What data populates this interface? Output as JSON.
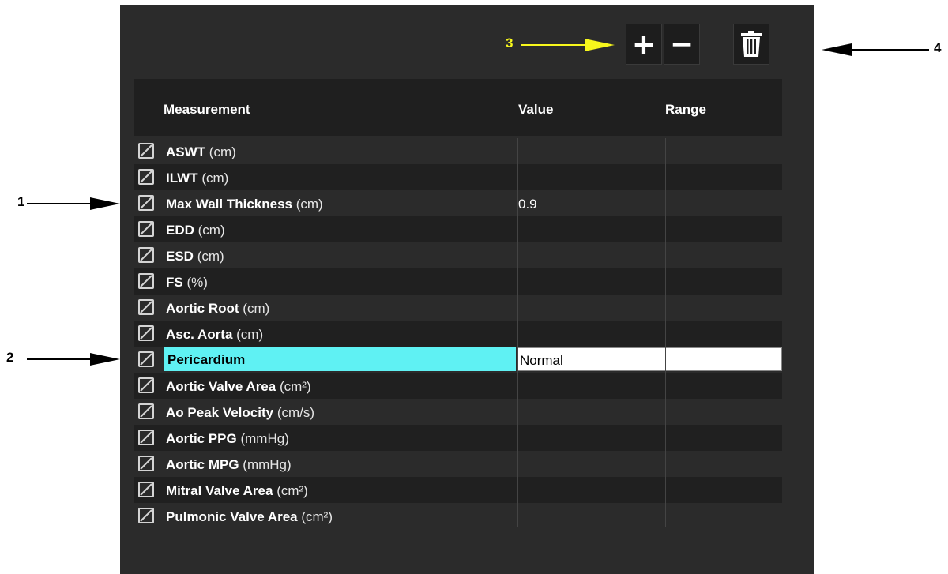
{
  "toolbar": {
    "add_label": "+",
    "remove_label": "−",
    "delete_icon": "trash-icon"
  },
  "table": {
    "headers": {
      "measurement": "Measurement",
      "value": "Value",
      "range": "Range"
    },
    "rows": [
      {
        "name": "ASWT",
        "unit": "(cm)",
        "value": "",
        "checked": true
      },
      {
        "name": "ILWT",
        "unit": "(cm)",
        "value": "",
        "checked": true
      },
      {
        "name": "Max Wall Thickness",
        "unit": "(cm)",
        "value": "0.9",
        "checked": true
      },
      {
        "name": "EDD",
        "unit": "(cm)",
        "value": "",
        "checked": true
      },
      {
        "name": "ESD",
        "unit": "(cm)",
        "value": "",
        "checked": true
      },
      {
        "name": "FS",
        "unit": "(%)",
        "value": "",
        "checked": true
      },
      {
        "name": "Aortic Root",
        "unit": "(cm)",
        "value": "",
        "checked": true
      },
      {
        "name": "Asc. Aorta",
        "unit": "(cm)",
        "value": "",
        "checked": true
      },
      {
        "name": "Pericardium",
        "unit": "",
        "value": "Normal",
        "checked": true,
        "editing": true
      },
      {
        "name": "Aortic Valve Area",
        "unit": "(cm²)",
        "value": "",
        "checked": true
      },
      {
        "name": "Ao Peak Velocity",
        "unit": "(cm/s)",
        "value": "",
        "checked": true
      },
      {
        "name": "Aortic PPG",
        "unit": "(mmHg)",
        "value": "",
        "checked": true
      },
      {
        "name": "Aortic MPG",
        "unit": "(mmHg)",
        "value": "",
        "checked": true
      },
      {
        "name": "Mitral Valve Area",
        "unit": "(cm²)",
        "value": "",
        "checked": true
      },
      {
        "name": "Pulmonic Valve Area",
        "unit": "(cm²)",
        "value": "",
        "checked": true
      }
    ]
  },
  "callouts": {
    "c1": "1",
    "c2": "2",
    "c3": "3",
    "c4": "4"
  },
  "colors": {
    "panel": "#2b2b2b",
    "edit_highlight": "#5ff1f3",
    "callout3": "#f7f71c"
  }
}
